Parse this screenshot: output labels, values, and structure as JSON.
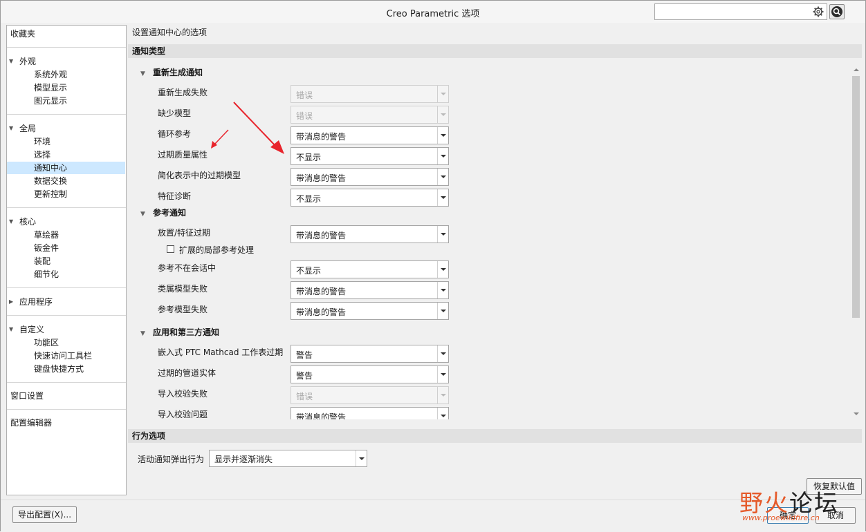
{
  "window": {
    "title": "Creo Parametric 选项",
    "search_placeholder": ""
  },
  "nav": {
    "favorites": "收藏夹",
    "appearance": {
      "label": "外观",
      "items": [
        "系统外观",
        "模型显示",
        "图元显示"
      ]
    },
    "global": {
      "label": "全局",
      "items": [
        "环境",
        "选择",
        "通知中心",
        "数据交换",
        "更新控制"
      ],
      "selected": "通知中心"
    },
    "core": {
      "label": "核心",
      "items": [
        "草绘器",
        "钣金件",
        "装配",
        "细节化"
      ]
    },
    "applications": "应用程序",
    "customize": {
      "label": "自定义",
      "items": [
        "功能区",
        "快速访问工具栏",
        "键盘快捷方式"
      ]
    },
    "window_settings": "窗口设置",
    "config_editor": "配置编辑器"
  },
  "content": {
    "description": "设置通知中心的选项",
    "notify_types_header": "通知类型",
    "regen": {
      "title": "重新生成通知",
      "rows": [
        {
          "label": "重新生成失败",
          "value": "错误",
          "disabled": true
        },
        {
          "label": "缺少模型",
          "value": "错误",
          "disabled": true
        },
        {
          "label": "循环参考",
          "value": "带消息的警告",
          "disabled": false
        },
        {
          "label": "过期质量属性",
          "value": "不显示",
          "disabled": false
        },
        {
          "label": "简化表示中的过期模型",
          "value": "带消息的警告",
          "disabled": false
        },
        {
          "label": "特征诊断",
          "value": "不显示",
          "disabled": false
        }
      ]
    },
    "reference": {
      "title": "参考通知",
      "placement": {
        "label": "放置/特征过期",
        "value": "带消息的警告"
      },
      "checkbox_label": "扩展的局部参考处理",
      "rows": [
        {
          "label": "参考不在会话中",
          "value": "不显示"
        },
        {
          "label": "类属模型失败",
          "value": "带消息的警告"
        },
        {
          "label": "参考模型失败",
          "value": "带消息的警告"
        }
      ]
    },
    "apps": {
      "title": "应用和第三方通知",
      "rows": [
        {
          "label": "嵌入式 PTC  Mathcad 工作表过期",
          "value": "警告",
          "disabled": false
        },
        {
          "label": "过期的管道实体",
          "value": "警告",
          "disabled": false
        },
        {
          "label": "导入校验失败",
          "value": "错误",
          "disabled": true
        },
        {
          "label": "导入校验问题",
          "value": "带消息的警告",
          "disabled": false
        }
      ]
    },
    "behavior_header": "行为选项",
    "popup_label": "活动通知弹出行为",
    "popup_value": "显示并逐渐消失"
  },
  "buttons": {
    "restore_defaults": "恢复默认值",
    "export_config": "导出配置(X)...",
    "ok": "确定",
    "cancel": "取消"
  },
  "watermark": {
    "text_a": "野火",
    "text_b": "论坛",
    "url": "www.proewildfire.cn"
  },
  "colors": {
    "selection": "#cde8ff",
    "annotation_arrow": "#e8242c",
    "watermark": "#e55a2a"
  }
}
